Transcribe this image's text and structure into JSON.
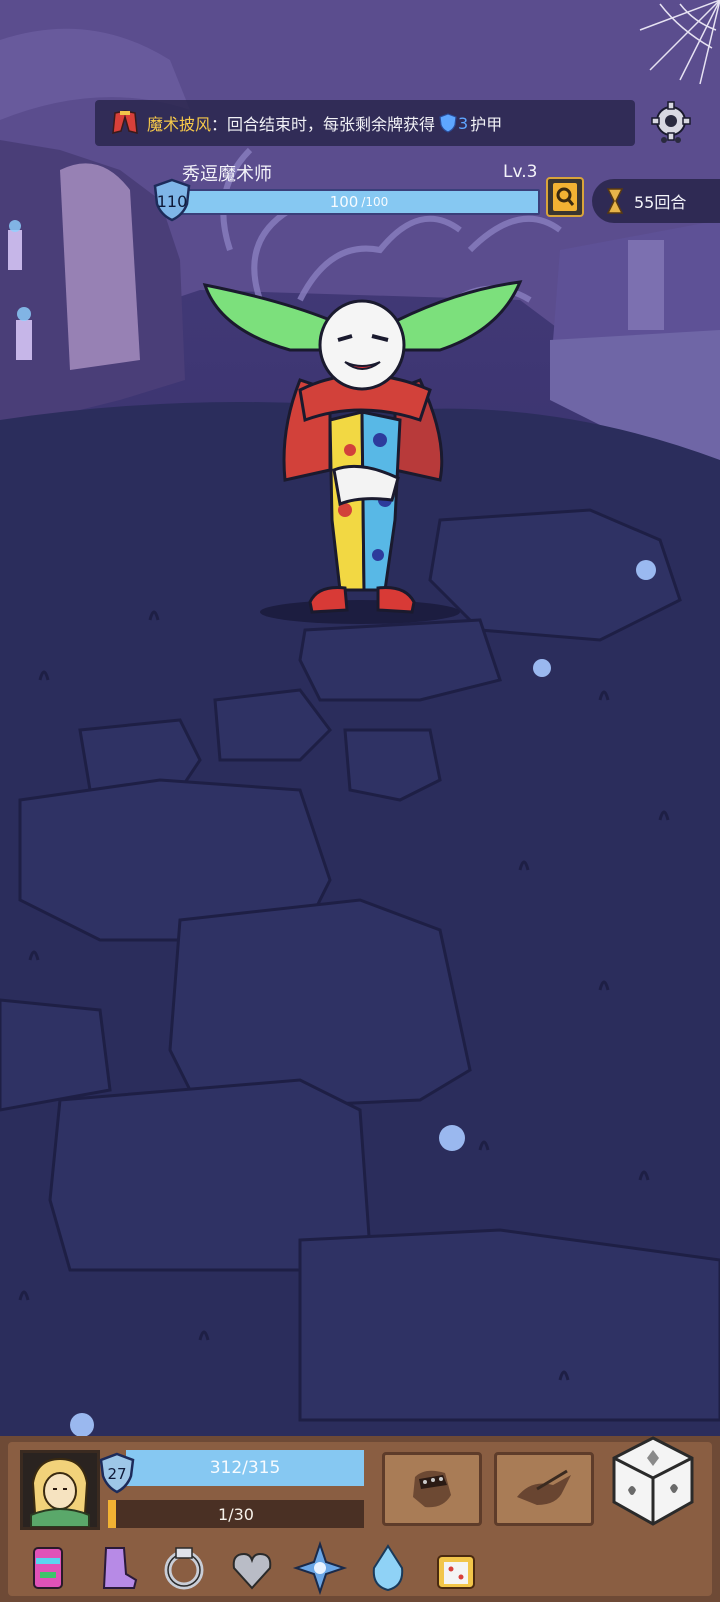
{
  "relic_banner": {
    "relic_name": "魔术披风",
    "text_part1": "：回合结束时，每张剩余牌获得",
    "armor_value": "3",
    "text_part2": "护甲",
    "relic_icon": "red-cloak-icon",
    "armor_icon": "shield-icon"
  },
  "settings": {
    "icon": "gear-icon"
  },
  "enemy": {
    "name": "秀逗魔术师",
    "level_label": "Lv.3",
    "shield_value": "110",
    "hp_current": "100",
    "hp_max": "/100",
    "hp_fraction": 1.0,
    "intent_icon": "magnifier-icon"
  },
  "turn_counter": {
    "label": "55回合",
    "icon": "hourglass-icon"
  },
  "hero": {
    "level": "27",
    "hp_text": "312/315",
    "hp_fraction": 0.99,
    "xp_text": "1/30",
    "xp_fraction": 0.033,
    "portrait_icon": "hero-portrait"
  },
  "skills": [
    {
      "name": "fist-skill",
      "icon": "spiked-fist-icon"
    },
    {
      "name": "bird-skill",
      "icon": "sparrow-icon"
    }
  ],
  "dice": {
    "icon": "dice-icon"
  },
  "relics": [
    {
      "icon": "totem-mask-icon"
    },
    {
      "icon": "purple-boot-icon"
    },
    {
      "icon": "silver-ring-icon"
    },
    {
      "icon": "winged-heart-icon"
    },
    {
      "icon": "blue-compass-icon"
    },
    {
      "icon": "crystal-drop-icon"
    },
    {
      "icon": "dice-cup-icon"
    }
  ],
  "colors": {
    "hp_bar": "#86c8f2",
    "xp_bar": "#f2b233",
    "banner_name": "#f6c94a",
    "armor": "#5ea6ff",
    "hud_wood": "#8a5e42"
  }
}
